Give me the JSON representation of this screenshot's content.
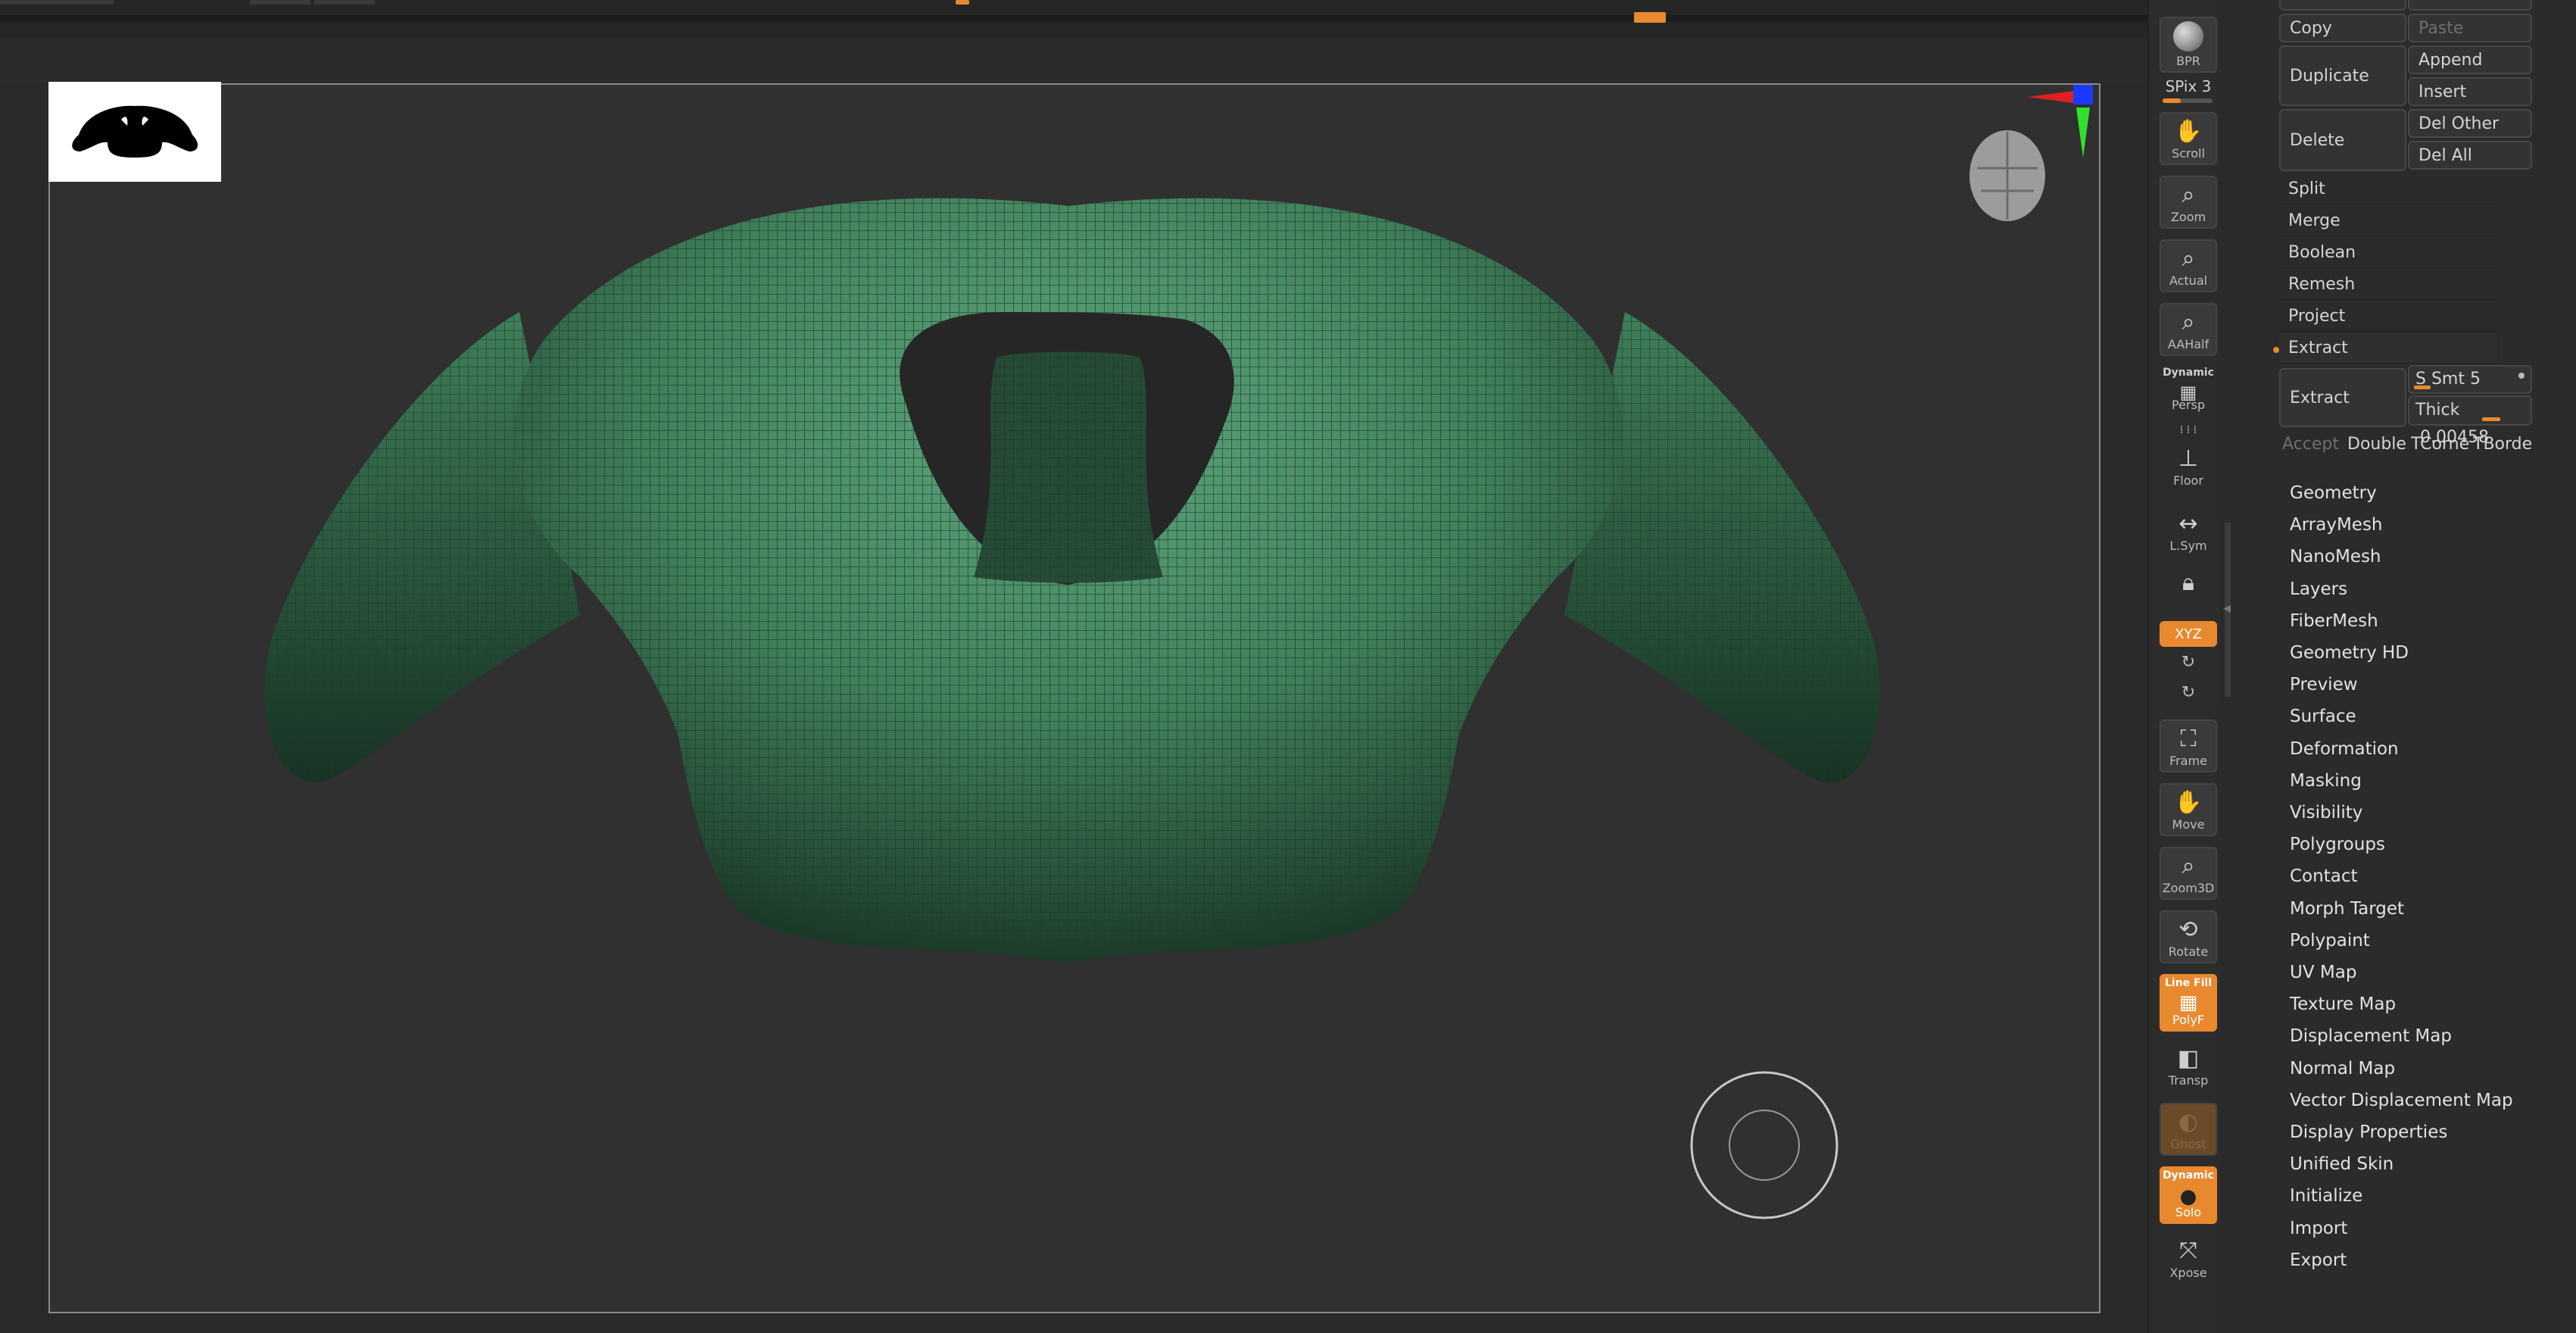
{
  "colors": {
    "accent": "#e8892f",
    "mesh": "#3f7f5a",
    "canvas": "#303030"
  },
  "shelf": {
    "bpr": "BPR",
    "spix": "SPix 3",
    "scroll": "Scroll",
    "zoom": "Zoom",
    "actual": "Actual",
    "aahalf": "AAHalf",
    "persp_top": "Dynamic",
    "persp": "Persp",
    "floor": "Floor",
    "lsym": "L.Sym",
    "xyz": "XYZ",
    "frame": "Frame",
    "move": "Move",
    "zoom3d": "Zoom3D",
    "rotate": "Rotate",
    "polyf_top": "Line Fill",
    "polyf": "PolyF",
    "transp": "Transp",
    "ghost": "Ghost",
    "solo_top": "Dynamic",
    "solo": "Solo",
    "xpose": "Xpose"
  },
  "subtool": {
    "copy": "Copy",
    "paste": "Paste",
    "duplicate": "Duplicate",
    "append": "Append",
    "insert": "Insert",
    "delete": "Delete",
    "del_other": "Del Other",
    "del_all": "Del All",
    "split": "Split",
    "merge": "Merge",
    "boolean": "Boolean",
    "remesh": "Remesh",
    "project": "Project",
    "extract_header": "Extract",
    "extract_button": "Extract",
    "s_smt": "S Smt 5",
    "thick_label": "Thick",
    "thick_value": "0.00458",
    "accept": "Accept",
    "double": "Double",
    "tcorner": "TCorne",
    "tborder": "TBorde"
  },
  "tool_menu": [
    "Geometry",
    "ArrayMesh",
    "NanoMesh",
    "Layers",
    "FiberMesh",
    "Geometry HD",
    "Preview",
    "Surface",
    "Deformation",
    "Masking",
    "Visibility",
    "Polygroups",
    "Contact",
    "Morph Target",
    "Polypaint",
    "UV Map",
    "Texture Map",
    "Displacement Map",
    "Normal Map",
    "Vector Displacement Map",
    "Display Properties",
    "Unified Skin",
    "Initialize",
    "Import",
    "Export"
  ]
}
